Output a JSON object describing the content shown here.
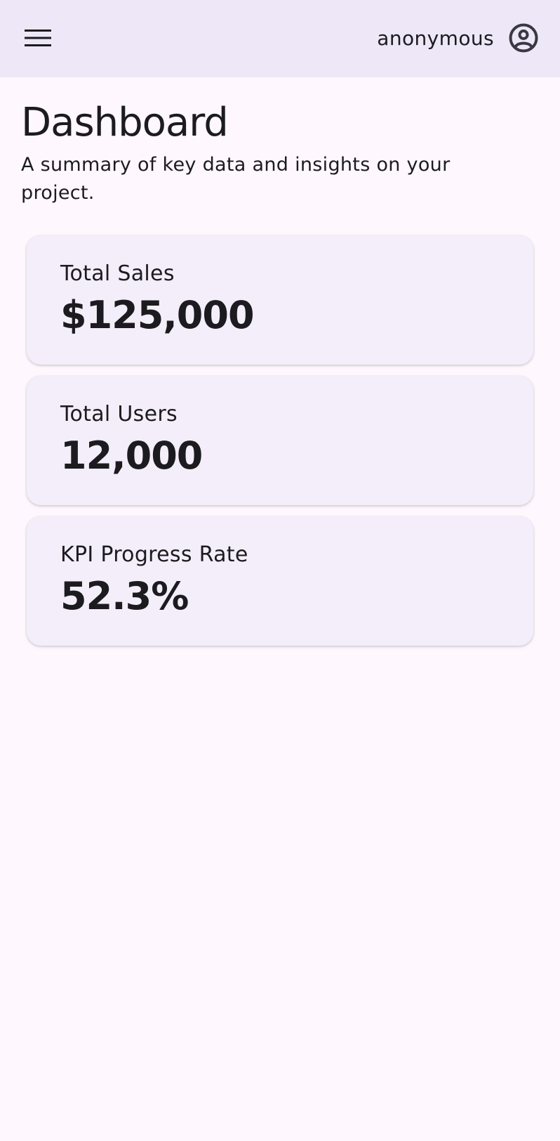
{
  "app_bar": {
    "menu_icon": "hamburger-menu-icon",
    "username": "anonymous",
    "account_icon": "account-circle-icon",
    "background_color": "#ede7f7"
  },
  "header": {
    "title": "Dashboard",
    "subtitle": "A summary of key data and insights on your project."
  },
  "cards": [
    {
      "label": "Total Sales",
      "value": "$125,000"
    },
    {
      "label": "Total Users",
      "value": "12,000"
    },
    {
      "label": "KPI Progress Rate",
      "value": "52.3%"
    }
  ],
  "colors": {
    "page_background": "#fef7fe",
    "card_background": "#f3eef9",
    "text": "#1c1b1f"
  }
}
